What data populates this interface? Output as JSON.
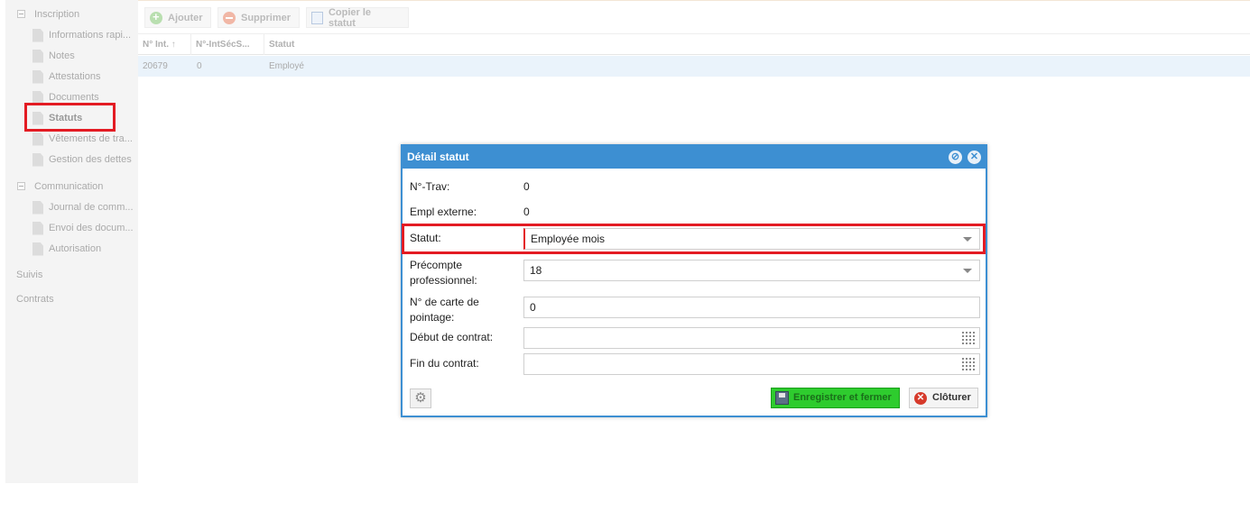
{
  "sidebar": {
    "groups": [
      {
        "label": "Inscription",
        "items": [
          {
            "label": "Informations rapi..."
          },
          {
            "label": "Notes"
          },
          {
            "label": "Attestations"
          },
          {
            "label": "Documents"
          },
          {
            "label": "Statuts"
          },
          {
            "label": "Vêtements de tra..."
          },
          {
            "label": "Gestion des dettes"
          }
        ]
      },
      {
        "label": "Communication",
        "items": [
          {
            "label": "Journal de comm..."
          },
          {
            "label": "Envoi des docum..."
          },
          {
            "label": "Autorisation"
          }
        ]
      }
    ],
    "root_items": [
      {
        "label": "Suivis"
      },
      {
        "label": "Contrats"
      }
    ]
  },
  "toolbar": {
    "add_label": "Ajouter",
    "delete_label": "Supprimer",
    "copy_label": "Copier le statut"
  },
  "grid": {
    "columns": [
      "N° Int.",
      "N°-IntSécS...",
      "Statut"
    ],
    "sort_indicator": "↑",
    "rows": [
      [
        "20679",
        "0",
        "Employé"
      ]
    ]
  },
  "dialog": {
    "title": "Détail statut",
    "fields": {
      "ntrav_label": "N°-Trav:",
      "ntrav_value": "0",
      "empl_label": "Empl externe:",
      "empl_value": "0",
      "statut_label": "Statut:",
      "statut_value": "Employée mois",
      "precompte_label": "Précompte professionnel:",
      "precompte_value": "18",
      "carte_label": "N° de carte de pointage:",
      "carte_value": "0",
      "debut_label": "Début de contrat:",
      "debut_value": "",
      "fin_label": "Fin du contrat:",
      "fin_value": ""
    },
    "save_label": "Enregistrer et fermer",
    "close_label": "Clôturer"
  },
  "colors": {
    "dialog_header": "#3d8fd2",
    "highlight": "#e31b23",
    "save_button": "#2ecc2e",
    "selected_row": "#eaf3fb"
  }
}
